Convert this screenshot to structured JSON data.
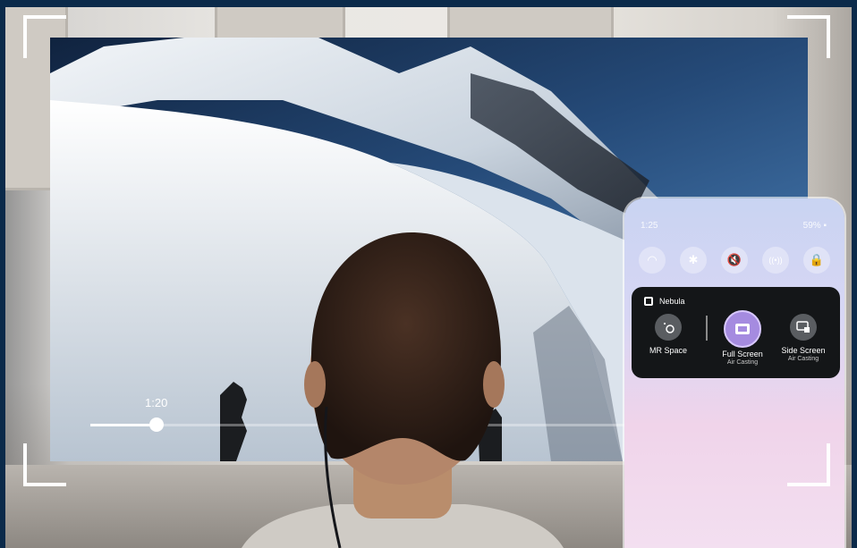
{
  "video": {
    "current_time": "1:20",
    "progress": 0.097
  },
  "phone": {
    "status_time": "1:25",
    "battery": "59%",
    "quick_settings": [
      {
        "name": "wifi-icon",
        "glyph": "◠"
      },
      {
        "name": "bluetooth-icon",
        "glyph": "✱"
      },
      {
        "name": "mute-icon",
        "glyph": "🔇"
      },
      {
        "name": "hotspot-icon",
        "glyph": "((•))"
      },
      {
        "name": "lock-icon",
        "glyph": "🔒"
      }
    ],
    "cast_panel": {
      "app_name": "Nebula",
      "options": [
        {
          "label": "MR Space",
          "sub": "",
          "selected": false
        },
        {
          "label": "Full Screen",
          "sub": "Air Casting",
          "selected": true
        },
        {
          "label": "Side Screen",
          "sub": "Air Casting",
          "selected": false
        }
      ]
    }
  },
  "colors": {
    "accent": "#a58be0",
    "panel": "#141618",
    "frame": "#0b2a4a"
  }
}
